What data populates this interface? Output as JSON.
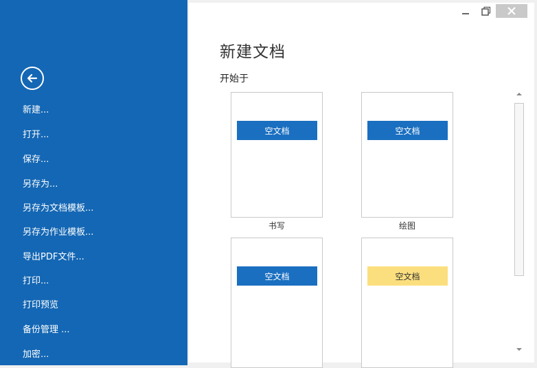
{
  "sidebar": {
    "menu": [
      {
        "label": "新建..."
      },
      {
        "label": "打开..."
      },
      {
        "label": "保存..."
      },
      {
        "label": "另存为..."
      },
      {
        "label": "另存为文档模板..."
      },
      {
        "label": "另存为作业模板..."
      },
      {
        "label": "导出PDF文件..."
      },
      {
        "label": "打印..."
      },
      {
        "label": "打印预览"
      },
      {
        "label": "备份管理 ..."
      },
      {
        "label": "加密..."
      }
    ],
    "back_icon": "arrow-left-circle-icon",
    "bg_color": "#1467b4"
  },
  "window_controls": {
    "icons": [
      "minimize-icon",
      "restore-icon",
      "close-icon"
    ]
  },
  "main": {
    "title": "新建文档",
    "subtitle": "开始于",
    "templates": [
      {
        "bar_label": "空文档",
        "caption": "书写",
        "bar_color": "#1a6fc0"
      },
      {
        "bar_label": "空文档",
        "caption": "绘图",
        "bar_color": "#1a6fc0"
      },
      {
        "bar_label": "空文档",
        "caption": "",
        "bar_color": "#1a6fc0"
      },
      {
        "bar_label": "空文档",
        "caption": "",
        "bar_color": "#fbdf7e"
      }
    ]
  }
}
